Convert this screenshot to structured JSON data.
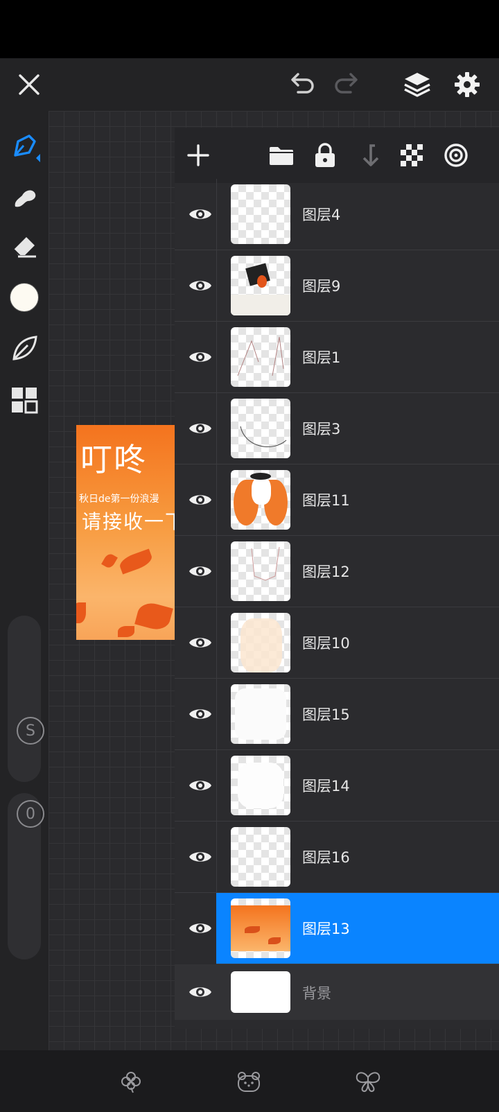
{
  "topbar": {
    "close": "close",
    "undo": "undo",
    "redo": "redo",
    "layers": "layers",
    "settings": "settings"
  },
  "sidebar": {
    "tools": [
      "brush",
      "smudge",
      "eraser",
      "color",
      "liquify",
      "grid"
    ],
    "color_swatch": "#fdfaf2",
    "slider_size_label": "S",
    "slider_opacity_label": "0"
  },
  "artwork": {
    "title": "叮咚",
    "subtitle": "秋日de第一份浪漫",
    "line2": "请接收一下w"
  },
  "layers_panel": {
    "toolbar": [
      "add",
      "folder",
      "lock",
      "merge-down",
      "transparency",
      "target"
    ],
    "layers": [
      {
        "name": "图层4",
        "thumb": "transparent",
        "active": false
      },
      {
        "name": "图层9",
        "thumb": "dark-sketch",
        "active": false
      },
      {
        "name": "图层1",
        "thumb": "line",
        "active": false
      },
      {
        "name": "图层3",
        "thumb": "line",
        "active": false
      },
      {
        "name": "图层11",
        "thumb": "orange-hair",
        "active": false
      },
      {
        "name": "图层12",
        "thumb": "line",
        "active": false
      },
      {
        "name": "图层10",
        "thumb": "skin",
        "active": false
      },
      {
        "name": "图层15",
        "thumb": "white",
        "active": false
      },
      {
        "name": "图层14",
        "thumb": "white",
        "active": false
      },
      {
        "name": "图层16",
        "thumb": "transparent",
        "active": false
      },
      {
        "name": "图层13",
        "thumb": "orange-bg",
        "active": true
      }
    ],
    "background_layer": "背景"
  },
  "colors": {
    "accent": "#0a84ff",
    "panel": "#2b2b2e",
    "toolbar": "#232325"
  },
  "bottombar": [
    "clover",
    "bear",
    "butterfly"
  ]
}
